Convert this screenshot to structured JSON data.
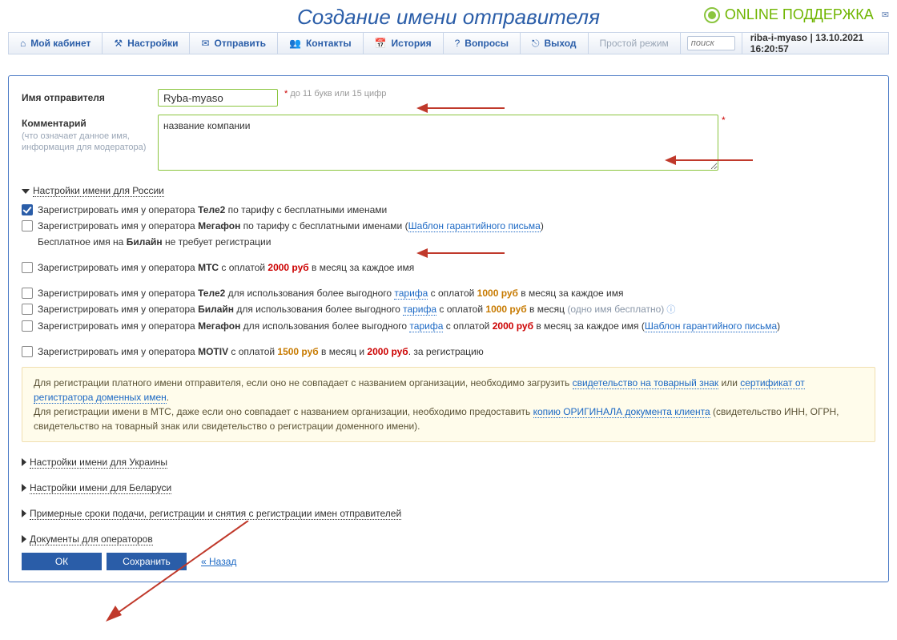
{
  "header": {
    "title": "Создание имени отправителя",
    "support": "ONLINE ПОДДЕРЖКА"
  },
  "nav": {
    "items": [
      "Мой кабинет",
      "Настройки",
      "Отправить",
      "Контакты",
      "История",
      "Вопросы",
      "Выход"
    ],
    "mode": "Простой режим",
    "search_placeholder": "поиск",
    "user": "riba-i-myaso | 13.10.2021 16:20:57"
  },
  "form": {
    "sender_label": "Имя отправителя",
    "sender_value": "Ryba-myaso",
    "sender_hint": "до 11 букв или 15 цифр",
    "comment_label": "Комментарий",
    "comment_sub": "(что означает данное имя, информация для модератора)",
    "comment_value": "название компании"
  },
  "russia": {
    "title": "Настройки имени для России",
    "line1_a": "Зарегистрировать имя у оператора ",
    "line1_b": "Теле2",
    "line1_c": " по тарифу с бесплатными именами",
    "line2_a": "Зарегистрировать имя у оператора ",
    "line2_b": "Мегафон",
    "line2_c": " по тарифу с бесплатными именами (",
    "line2_link": "Шаблон гарантийного письма",
    "line2_d": ")",
    "line3_a": "Бесплатное имя на ",
    "line3_b": "Билайн",
    "line3_c": " не требует регистрации",
    "line4_a": "Зарегистрировать имя у оператора ",
    "line4_b": "МТС",
    "line4_c": " с оплатой ",
    "line4_price": "2000 руб",
    "line4_d": " в месяц за каждое имя",
    "line5_a": "Зарегистрировать имя у оператора ",
    "line5_b": "Теле2",
    "line5_c": " для использования более выгодного ",
    "line5_link": "тарифа",
    "line5_d": " с оплатой ",
    "line5_price": "1000 руб",
    "line5_e": " в месяц за каждое имя",
    "line6_a": "Зарегистрировать имя у оператора ",
    "line6_b": "Билайн",
    "line6_c": " для использования более выгодного ",
    "line6_link": "тарифа",
    "line6_d": " с оплатой ",
    "line6_price": "1000 руб",
    "line6_e": " в месяц ",
    "line6_grey": "(одно имя бесплатно)",
    "line7_a": "Зарегистрировать имя у оператора ",
    "line7_b": "Мегафон",
    "line7_c": " для использования более выгодного ",
    "line7_link": "тарифа",
    "line7_d": " с оплатой ",
    "line7_price": "2000 руб",
    "line7_e": " в месяц за каждое имя (",
    "line7_link2": "Шаблон гарантийного письма",
    "line7_f": ")",
    "line8_a": "Зарегистрировать имя у оператора ",
    "line8_b": "MOTIV",
    "line8_c": " с оплатой ",
    "line8_price1": "1500 руб",
    "line8_d": " в месяц и ",
    "line8_price2": "2000 руб",
    "line8_e": ". за регистрацию"
  },
  "info": {
    "l1_a": "Для регистрации платного имени отправителя, если оно не совпадает с названием организации, необходимо загрузить ",
    "l1_link1": "свидетельство на товарный знак",
    "l1_b": " или ",
    "l1_link2": "сертификат от регистратора доменных имен",
    "l1_c": ".",
    "l2_a": "Для регистрации имени в МТС, даже если оно совпадает с названием организации, необходимо предоставить ",
    "l2_link": "копию ОРИГИНАЛА документа клиента",
    "l2_b": " (свидетельство ИНН, ОГРН, свидетельство на товарный знак или свидетельство о регистрации доменного имени)."
  },
  "collapsed": [
    "Настройки имени для Украины",
    "Настройки имени для Беларуси",
    "Примерные сроки подачи, регистрации и снятия с регистрации имен отправителей",
    "Документы для операторов"
  ],
  "buttons": {
    "ok": "ОК",
    "save": "Сохранить",
    "back": "« Назад"
  }
}
